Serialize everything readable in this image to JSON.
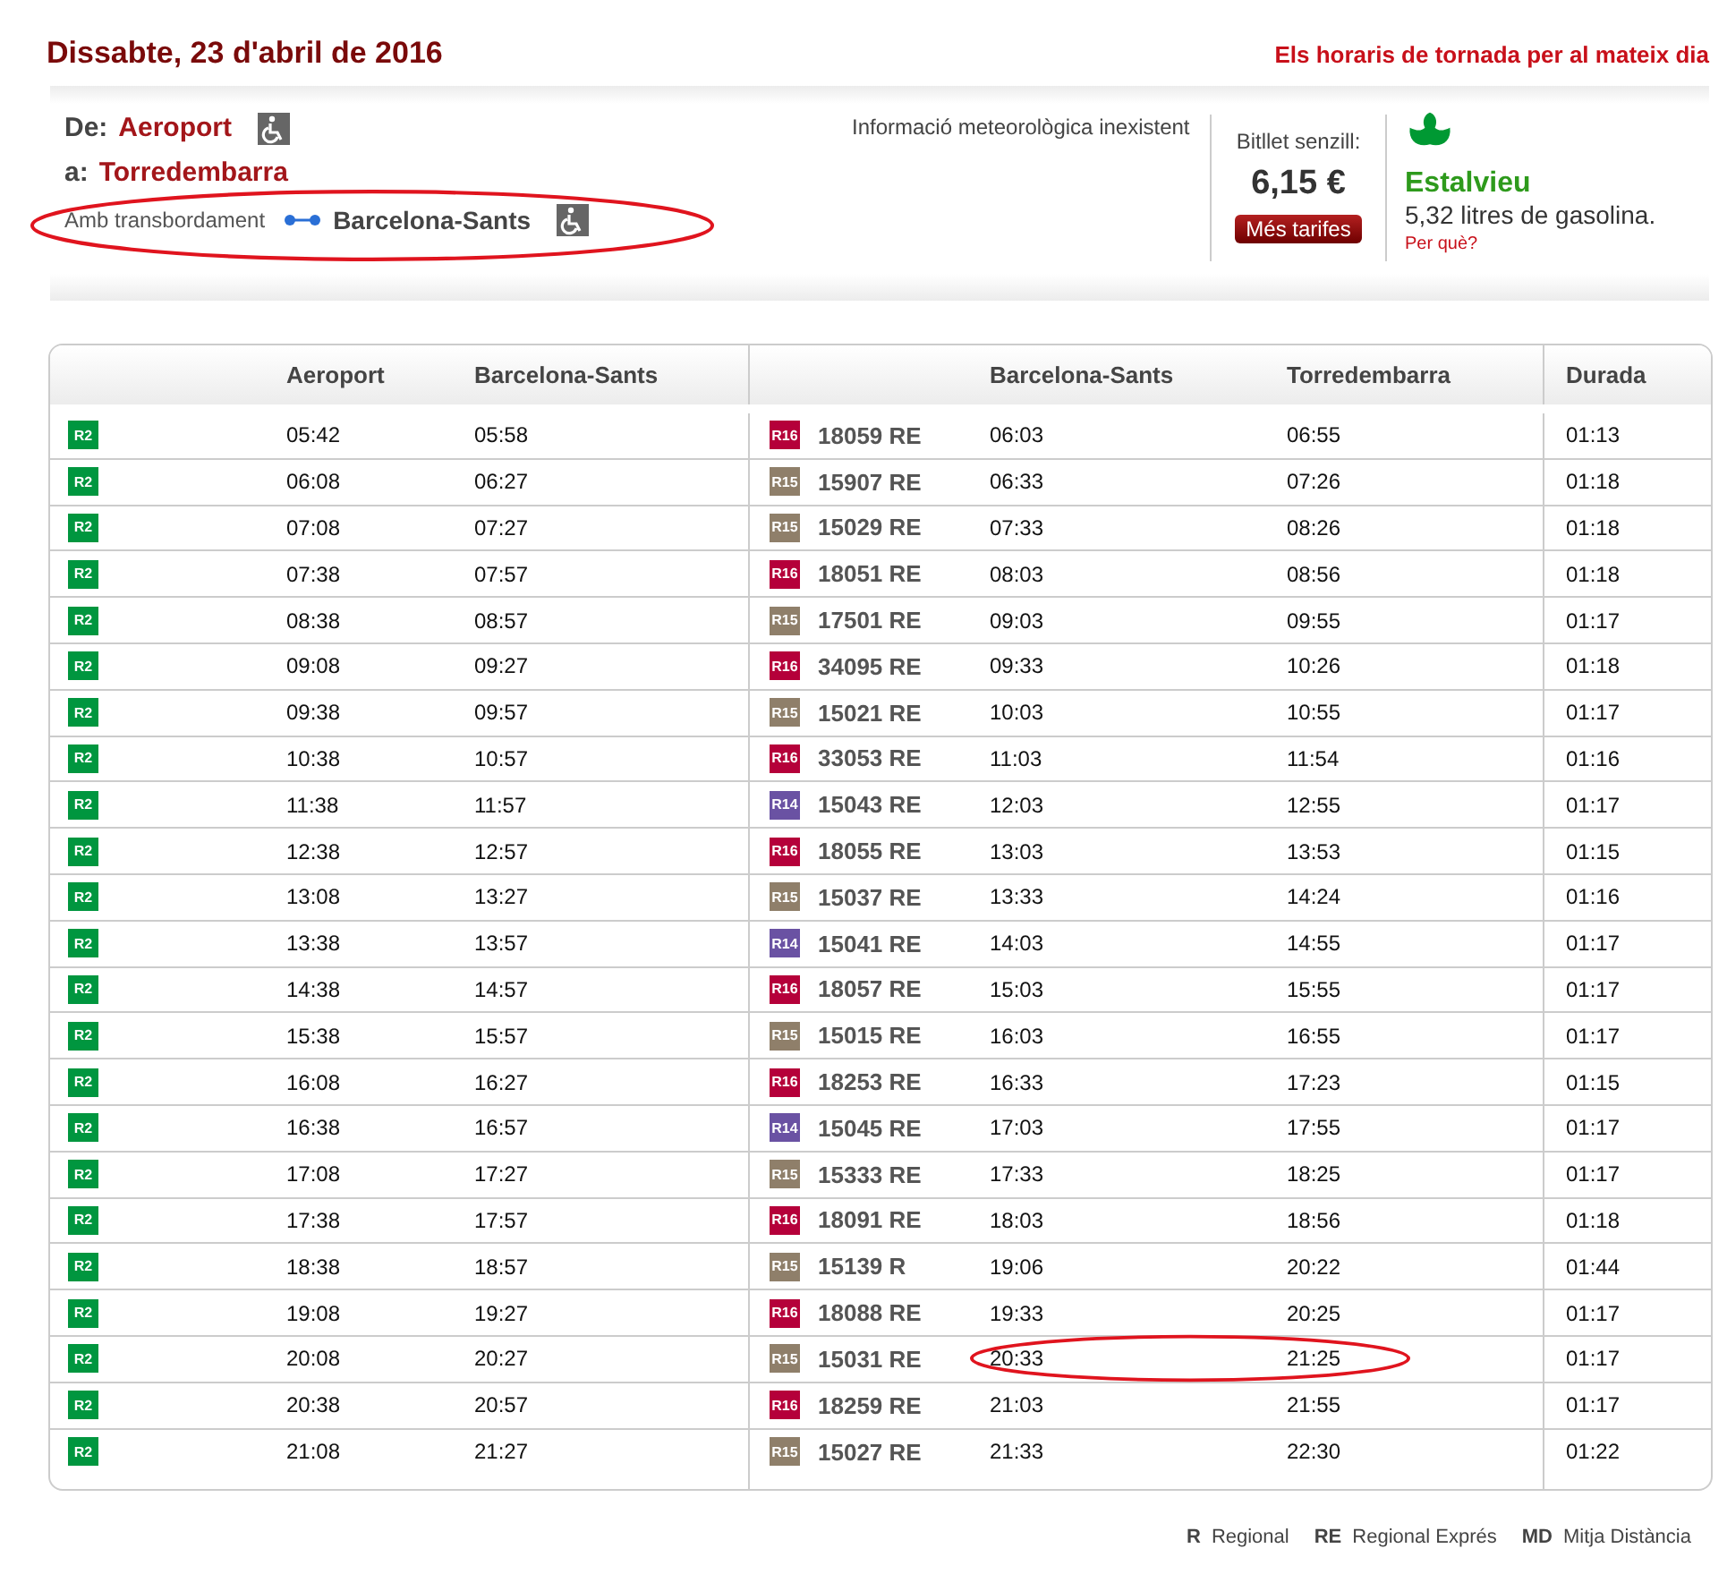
{
  "date": "Dissabte, 23 d'abril de 2016",
  "return_link": "Els horaris de tornada per al mateix dia",
  "route": {
    "from_label": "De:",
    "from": "Aeroport",
    "to_label": "a:",
    "to": "Torredembarra",
    "transfer_label": "Amb transbordament",
    "transfer_station": "Barcelona-Sants",
    "circled": true
  },
  "weather": "Informació meteorològica inexistent",
  "ticket": {
    "label": "Bitllet senzill:",
    "price": "6,15 €",
    "button": "Més tarifes"
  },
  "savings": {
    "title": "Estalvieu",
    "text": "5,32 litres de gasolina.",
    "link": "Per què?"
  },
  "table": {
    "columns": [
      "Aeroport",
      "Barcelona-Sants",
      "Barcelona-Sants",
      "Torredembarra",
      "Durada"
    ],
    "rows": [
      {
        "line1": {
          "code": "R2",
          "color": "#00963f"
        },
        "dep1": "05:42",
        "arr1": "05:58",
        "line2": {
          "code": "R16",
          "color": "#b5003a"
        },
        "train": "18059 RE",
        "dep2": "06:03",
        "arr2": "06:55",
        "duration": "01:13",
        "circled": false
      },
      {
        "line1": {
          "code": "R2",
          "color": "#00963f"
        },
        "dep1": "06:08",
        "arr1": "06:27",
        "line2": {
          "code": "R15",
          "color": "#8f7f6a"
        },
        "train": "15907 RE",
        "dep2": "06:33",
        "arr2": "07:26",
        "duration": "01:18",
        "circled": false
      },
      {
        "line1": {
          "code": "R2",
          "color": "#00963f"
        },
        "dep1": "07:08",
        "arr1": "07:27",
        "line2": {
          "code": "R15",
          "color": "#8f7f6a"
        },
        "train": "15029 RE",
        "dep2": "07:33",
        "arr2": "08:26",
        "duration": "01:18",
        "circled": false
      },
      {
        "line1": {
          "code": "R2",
          "color": "#00963f"
        },
        "dep1": "07:38",
        "arr1": "07:57",
        "line2": {
          "code": "R16",
          "color": "#b5003a"
        },
        "train": "18051 RE",
        "dep2": "08:03",
        "arr2": "08:56",
        "duration": "01:18",
        "circled": false
      },
      {
        "line1": {
          "code": "R2",
          "color": "#00963f"
        },
        "dep1": "08:38",
        "arr1": "08:57",
        "line2": {
          "code": "R15",
          "color": "#8f7f6a"
        },
        "train": "17501 RE",
        "dep2": "09:03",
        "arr2": "09:55",
        "duration": "01:17",
        "circled": false
      },
      {
        "line1": {
          "code": "R2",
          "color": "#00963f"
        },
        "dep1": "09:08",
        "arr1": "09:27",
        "line2": {
          "code": "R16",
          "color": "#b5003a"
        },
        "train": "34095 RE",
        "dep2": "09:33",
        "arr2": "10:26",
        "duration": "01:18",
        "circled": false
      },
      {
        "line1": {
          "code": "R2",
          "color": "#00963f"
        },
        "dep1": "09:38",
        "arr1": "09:57",
        "line2": {
          "code": "R15",
          "color": "#8f7f6a"
        },
        "train": "15021 RE",
        "dep2": "10:03",
        "arr2": "10:55",
        "duration": "01:17",
        "circled": false
      },
      {
        "line1": {
          "code": "R2",
          "color": "#00963f"
        },
        "dep1": "10:38",
        "arr1": "10:57",
        "line2": {
          "code": "R16",
          "color": "#b5003a"
        },
        "train": "33053 RE",
        "dep2": "11:03",
        "arr2": "11:54",
        "duration": "01:16",
        "circled": false
      },
      {
        "line1": {
          "code": "R2",
          "color": "#00963f"
        },
        "dep1": "11:38",
        "arr1": "11:57",
        "line2": {
          "code": "R14",
          "color": "#6a52a3"
        },
        "train": "15043 RE",
        "dep2": "12:03",
        "arr2": "12:55",
        "duration": "01:17",
        "circled": false
      },
      {
        "line1": {
          "code": "R2",
          "color": "#00963f"
        },
        "dep1": "12:38",
        "arr1": "12:57",
        "line2": {
          "code": "R16",
          "color": "#b5003a"
        },
        "train": "18055 RE",
        "dep2": "13:03",
        "arr2": "13:53",
        "duration": "01:15",
        "circled": false
      },
      {
        "line1": {
          "code": "R2",
          "color": "#00963f"
        },
        "dep1": "13:08",
        "arr1": "13:27",
        "line2": {
          "code": "R15",
          "color": "#8f7f6a"
        },
        "train": "15037 RE",
        "dep2": "13:33",
        "arr2": "14:24",
        "duration": "01:16",
        "circled": false
      },
      {
        "line1": {
          "code": "R2",
          "color": "#00963f"
        },
        "dep1": "13:38",
        "arr1": "13:57",
        "line2": {
          "code": "R14",
          "color": "#6a52a3"
        },
        "train": "15041 RE",
        "dep2": "14:03",
        "arr2": "14:55",
        "duration": "01:17",
        "circled": false
      },
      {
        "line1": {
          "code": "R2",
          "color": "#00963f"
        },
        "dep1": "14:38",
        "arr1": "14:57",
        "line2": {
          "code": "R16",
          "color": "#b5003a"
        },
        "train": "18057 RE",
        "dep2": "15:03",
        "arr2": "15:55",
        "duration": "01:17",
        "circled": false
      },
      {
        "line1": {
          "code": "R2",
          "color": "#00963f"
        },
        "dep1": "15:38",
        "arr1": "15:57",
        "line2": {
          "code": "R15",
          "color": "#8f7f6a"
        },
        "train": "15015 RE",
        "dep2": "16:03",
        "arr2": "16:55",
        "duration": "01:17",
        "circled": false
      },
      {
        "line1": {
          "code": "R2",
          "color": "#00963f"
        },
        "dep1": "16:08",
        "arr1": "16:27",
        "line2": {
          "code": "R16",
          "color": "#b5003a"
        },
        "train": "18253 RE",
        "dep2": "16:33",
        "arr2": "17:23",
        "duration": "01:15",
        "circled": false
      },
      {
        "line1": {
          "code": "R2",
          "color": "#00963f"
        },
        "dep1": "16:38",
        "arr1": "16:57",
        "line2": {
          "code": "R14",
          "color": "#6a52a3"
        },
        "train": "15045 RE",
        "dep2": "17:03",
        "arr2": "17:55",
        "duration": "01:17",
        "circled": false
      },
      {
        "line1": {
          "code": "R2",
          "color": "#00963f"
        },
        "dep1": "17:08",
        "arr1": "17:27",
        "line2": {
          "code": "R15",
          "color": "#8f7f6a"
        },
        "train": "15333 RE",
        "dep2": "17:33",
        "arr2": "18:25",
        "duration": "01:17",
        "circled": false
      },
      {
        "line1": {
          "code": "R2",
          "color": "#00963f"
        },
        "dep1": "17:38",
        "arr1": "17:57",
        "line2": {
          "code": "R16",
          "color": "#b5003a"
        },
        "train": "18091 RE",
        "dep2": "18:03",
        "arr2": "18:56",
        "duration": "01:18",
        "circled": false
      },
      {
        "line1": {
          "code": "R2",
          "color": "#00963f"
        },
        "dep1": "18:38",
        "arr1": "18:57",
        "line2": {
          "code": "R15",
          "color": "#8f7f6a"
        },
        "train": "15139 R",
        "dep2": "19:06",
        "arr2": "20:22",
        "duration": "01:44",
        "circled": false
      },
      {
        "line1": {
          "code": "R2",
          "color": "#00963f"
        },
        "dep1": "19:08",
        "arr1": "19:27",
        "line2": {
          "code": "R16",
          "color": "#b5003a"
        },
        "train": "18088 RE",
        "dep2": "19:33",
        "arr2": "20:25",
        "duration": "01:17",
        "circled": false
      },
      {
        "line1": {
          "code": "R2",
          "color": "#00963f"
        },
        "dep1": "20:08",
        "arr1": "20:27",
        "line2": {
          "code": "R15",
          "color": "#8f7f6a"
        },
        "train": "15031 RE",
        "dep2": "20:33",
        "arr2": "21:25",
        "duration": "01:17",
        "circled": true
      },
      {
        "line1": {
          "code": "R2",
          "color": "#00963f"
        },
        "dep1": "20:38",
        "arr1": "20:57",
        "line2": {
          "code": "R16",
          "color": "#b5003a"
        },
        "train": "18259 RE",
        "dep2": "21:03",
        "arr2": "21:55",
        "duration": "01:17",
        "circled": false
      },
      {
        "line1": {
          "code": "R2",
          "color": "#00963f"
        },
        "dep1": "21:08",
        "arr1": "21:27",
        "line2": {
          "code": "R15",
          "color": "#8f7f6a"
        },
        "train": "15027 RE",
        "dep2": "21:33",
        "arr2": "22:30",
        "duration": "01:22",
        "circled": false
      }
    ]
  },
  "legend": [
    {
      "code": "R",
      "name": "Regional"
    },
    {
      "code": "RE",
      "name": "Regional Exprés"
    },
    {
      "code": "MD",
      "name": "Mitja Distància"
    }
  ]
}
